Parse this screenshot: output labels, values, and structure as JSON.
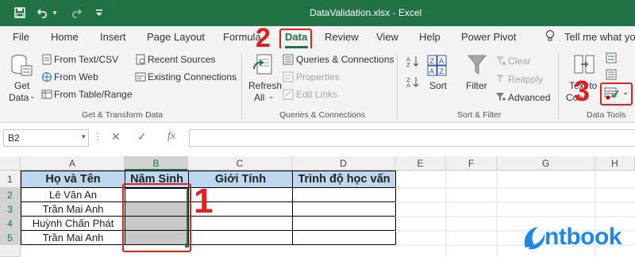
{
  "window": {
    "title": "DataValidation.xlsx  -  Excel"
  },
  "quick_access": {
    "save_icon": "save-icon",
    "undo_icon": "undo-icon",
    "redo_icon": "redo-icon"
  },
  "tabs": [
    "File",
    "Home",
    "Insert",
    "Page Layout",
    "Formula",
    "Data",
    "Review",
    "View",
    "Help",
    "Power Pivot"
  ],
  "tell_me": "Tell me what yo",
  "ribbon": {
    "get_data": {
      "label1": "Get",
      "label2": "Data"
    },
    "from_text": "From Text/CSV",
    "from_web": "From Web",
    "from_table": "From Table/Range",
    "recent_sources": "Recent Sources",
    "existing_connections": "Existing Connections",
    "group1": "Get & Transform Data",
    "refresh": {
      "label1": "Refresh",
      "label2": "All"
    },
    "queries_connections": "Queries & Connections",
    "properties": "Properties",
    "edit_links": "Edit Links",
    "group2": "Queries & Connections",
    "sort": "Sort",
    "filter": "Filter",
    "clear": "Clear",
    "reapply": "Reapply",
    "advanced": "Advanced",
    "group3": "Sort & Filter",
    "text_to_columns": {
      "label1": "Text to",
      "label2": "Colu"
    },
    "group4": "Data Tools"
  },
  "formula_bar": {
    "name_box": "B2",
    "fx": "fx",
    "value": ""
  },
  "columns": [
    "A",
    "B",
    "C",
    "D",
    "E",
    "F",
    "G",
    "H"
  ],
  "rows": [
    "1",
    "2",
    "3",
    "4",
    "5"
  ],
  "table": {
    "headers": [
      "Họ và Tên",
      "Năm Sinh",
      "Giới Tính",
      "Trình độ học vấn"
    ],
    "names": [
      "Lê Văn An",
      "Trần Mai Anh",
      "Huỳnh Chấn Phát",
      "Trần Mai Anh"
    ]
  },
  "callouts": {
    "one": "1",
    "two": "2",
    "three": "3"
  },
  "watermark": "ntbook",
  "colors": {
    "excel_green": "#217346",
    "header_fill": "#bdd7ee",
    "selection": "#c8c8c8",
    "callout_red": "#e02020"
  }
}
